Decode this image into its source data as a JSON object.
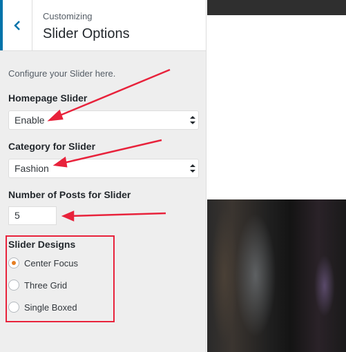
{
  "header": {
    "breadcrumb": "Customizing",
    "title": "Slider Options"
  },
  "description": "Configure your Slider here.",
  "homepage_slider": {
    "label": "Homepage Slider",
    "value": "Enable"
  },
  "category": {
    "label": "Category for Slider",
    "value": "Fashion"
  },
  "posts": {
    "label": "Number of Posts for Slider",
    "value": "5"
  },
  "designs": {
    "label": "Slider Designs",
    "options": [
      {
        "label": "Center Focus",
        "checked": true
      },
      {
        "label": "Three Grid",
        "checked": false
      },
      {
        "label": "Single Boxed",
        "checked": false
      }
    ]
  },
  "colors": {
    "accent": "#0073aa",
    "annotation": "#e8223b",
    "radio_checked": "#e67e22"
  }
}
